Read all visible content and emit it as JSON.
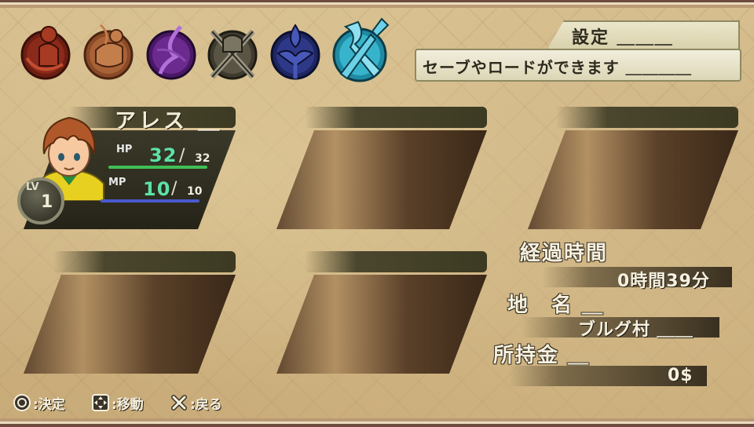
{
  "header": {
    "title": "設定 ＿＿＿",
    "description": "セーブやロードができます ＿＿＿＿"
  },
  "menu_icons": [
    {
      "name": "status-menu-icon",
      "color": "#7a2416",
      "selected": false
    },
    {
      "name": "items-menu-icon",
      "color": "#8a4a26",
      "selected": false
    },
    {
      "name": "magic-menu-icon",
      "color": "#5a1f7a",
      "selected": false
    },
    {
      "name": "equipment-menu-icon",
      "color": "#4a4436",
      "selected": false
    },
    {
      "name": "tactics-menu-icon",
      "color": "#26307a",
      "selected": false
    },
    {
      "name": "settings-menu-icon",
      "color": "#2f9fb8",
      "selected": true
    }
  ],
  "party": {
    "slot1": {
      "name": "アレス ＿",
      "hp_label": "HP",
      "hp": "32",
      "hp_max": "32",
      "mp_label": "MP",
      "mp": "10",
      "mp_max": "10",
      "lv_label": "LV",
      "level": "1",
      "hp_fill": 1.0,
      "mp_fill": 1.0
    }
  },
  "info": {
    "elapsed_label": "経過時間",
    "elapsed_value": "0時間39分",
    "location_label": "地　名 ＿",
    "location_value": "ブルグ村 ＿＿",
    "gold_label": "所持金 ＿",
    "gold_value": "0$"
  },
  "controls": {
    "confirm": ":決定",
    "move": ":移動",
    "back": ":戻る"
  },
  "colors": {
    "hp_bar": "#3fbf55",
    "mp_bar": "#4a5ad0",
    "panel_dark": "#3a3828"
  }
}
